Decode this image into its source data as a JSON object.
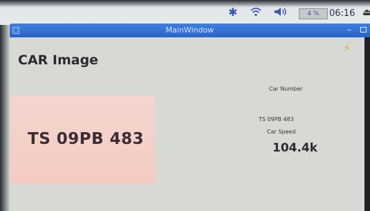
{
  "system_panel": {
    "bluetooth_icon": "bluetooth-icon",
    "wifi_icon": "wifi-icon",
    "volume_icon": "volume-icon",
    "battery_text": "4 %",
    "clock": "06:16",
    "eject_icon": "eject-icon"
  },
  "window": {
    "title": "MainWindow",
    "menu_glyph": "□",
    "minimize_glyph": "–"
  },
  "main": {
    "heading": "CAR Image",
    "plate_text": "TS 09PB 483",
    "car_number_label": "Car Number",
    "car_number_value": "TS 09PB 483",
    "car_speed_label": "Car Speed",
    "car_speed_value": "104.4k",
    "bolt_icon": "lightning-icon"
  },
  "colors": {
    "titlebar": "#3f7fdc",
    "plate_background": "#f3d6cf",
    "bolt": "#e6b320"
  }
}
